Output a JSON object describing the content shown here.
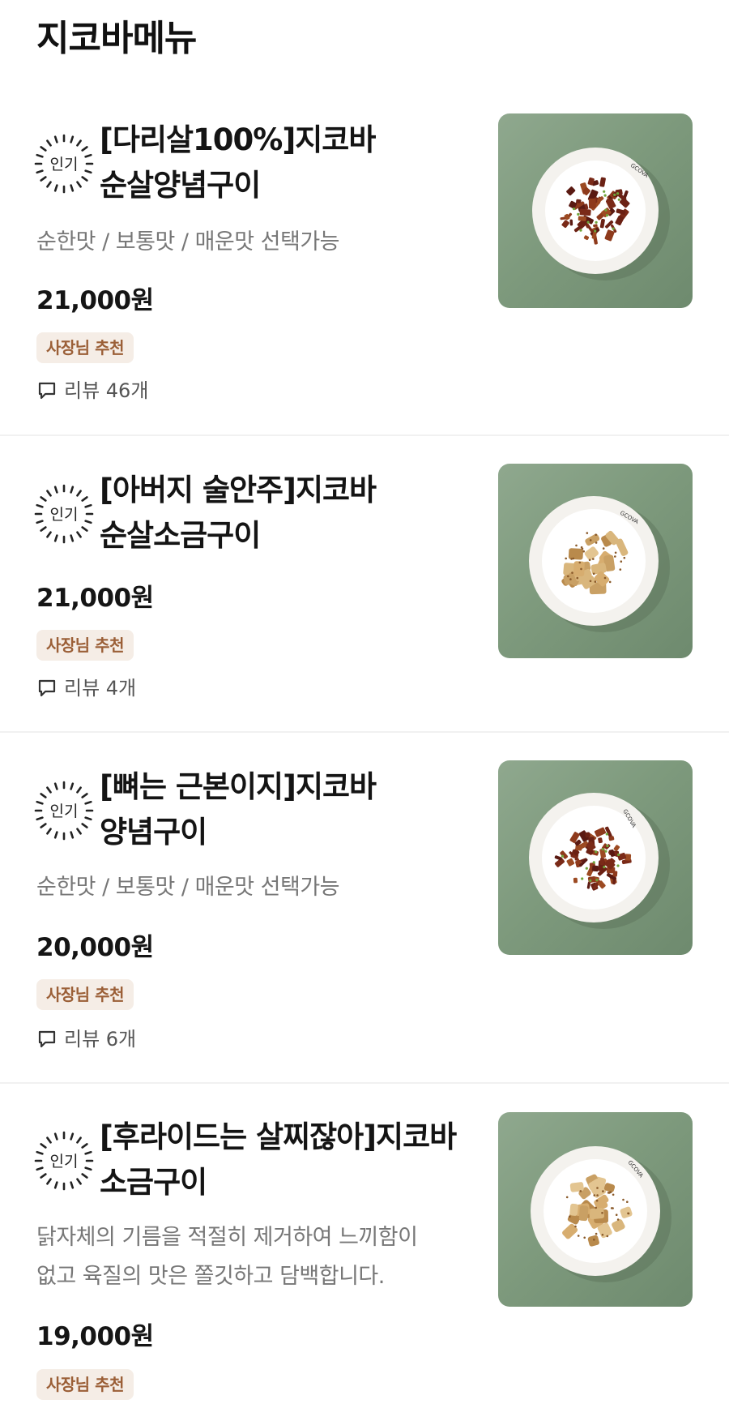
{
  "page": {
    "title": "지코바메뉴"
  },
  "colors": {
    "accent_badge_bg": "#f5ede6",
    "accent_badge_text": "#9b5f37",
    "thumbnail_bg": "#7e9a7d"
  },
  "items": [
    {
      "popular_label": "인기",
      "name_line1": "[다리살100%]지코바",
      "name_line2": "순살양념구이",
      "description": "순한맛 / 보통맛 / 매운맛 선택가능",
      "price": "21,000원",
      "badge": "사장님 추천",
      "review": "리뷰 46개",
      "dish": "red",
      "plate_text": "GCOVA"
    },
    {
      "popular_label": "인기",
      "name_line1": "[아버지 술안주]지코바",
      "name_line2": "순살소금구이",
      "description": "",
      "price": "21,000원",
      "badge": "사장님 추천",
      "review": "리뷰 4개",
      "dish": "salt",
      "plate_text": "GCOVA"
    },
    {
      "popular_label": "인기",
      "name_line1": "[뼈는 근본이지]지코바",
      "name_line2": "양념구이",
      "description": "순한맛 / 보통맛 / 매운맛 선택가능",
      "price": "20,000원",
      "badge": "사장님 추천",
      "review": "리뷰 6개",
      "dish": "red",
      "plate_text": "GCOVA"
    },
    {
      "popular_label": "인기",
      "name_line1": "[후라이드는 살찌잖아]지코바",
      "name_line2": "소금구이",
      "description_line1": "닭자체의 기름을 적절히 제거하여 느끼함이",
      "description_line2": "없고 육질의 맛은 쫄깃하고 담백합니다.",
      "price": "19,000원",
      "badge": "사장님 추천",
      "review": "",
      "dish": "salt",
      "plate_text": "GCOVA"
    }
  ]
}
